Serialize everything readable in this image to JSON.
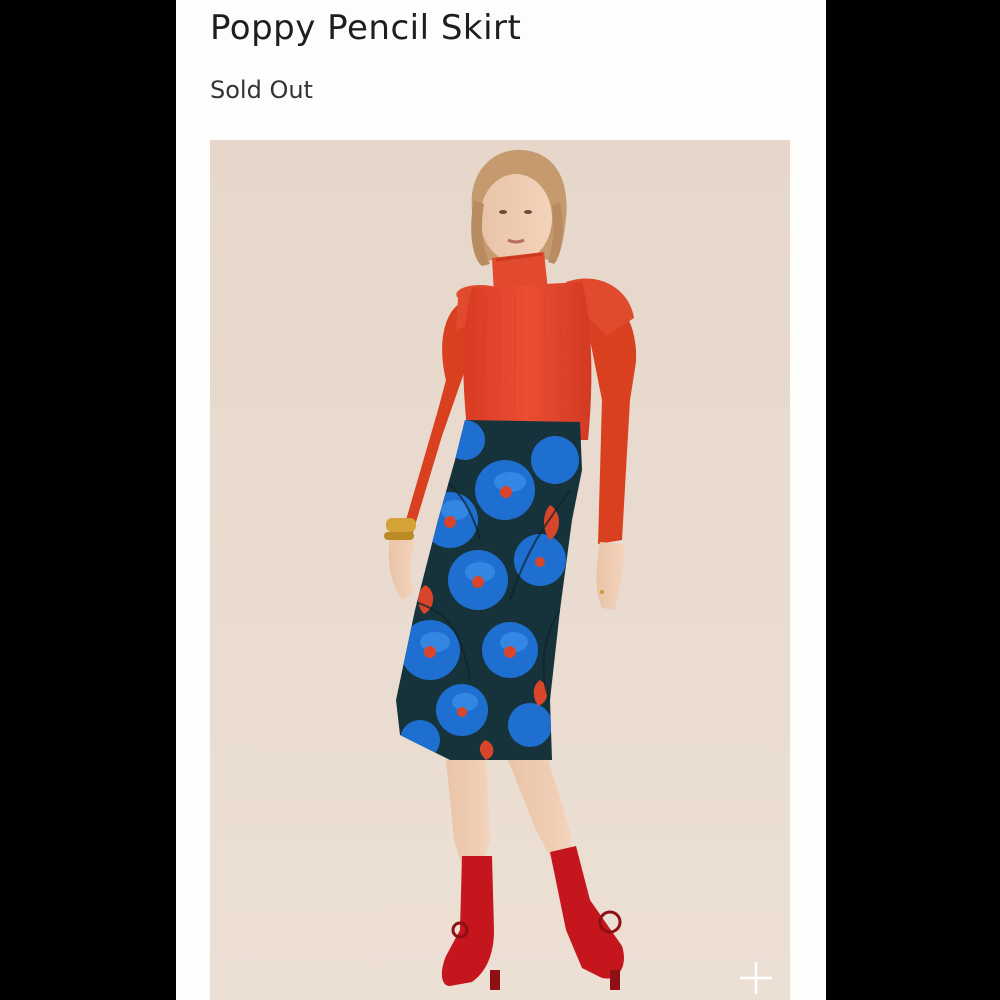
{
  "product": {
    "title": "Poppy Pencil Skirt",
    "availability": "Sold Out"
  },
  "image": {
    "subject": "model wearing red turtleneck, blue floral pencil skirt and red ankle boots",
    "zoom_icon": "plus-icon"
  },
  "colors": {
    "page_background": "#000000",
    "card_background": "#fdfdfb",
    "photo_backdrop": "#e7d9cc",
    "sweater": "#e0452c",
    "skirt_blue": "#1f6fd1",
    "boots": "#c4161c"
  }
}
